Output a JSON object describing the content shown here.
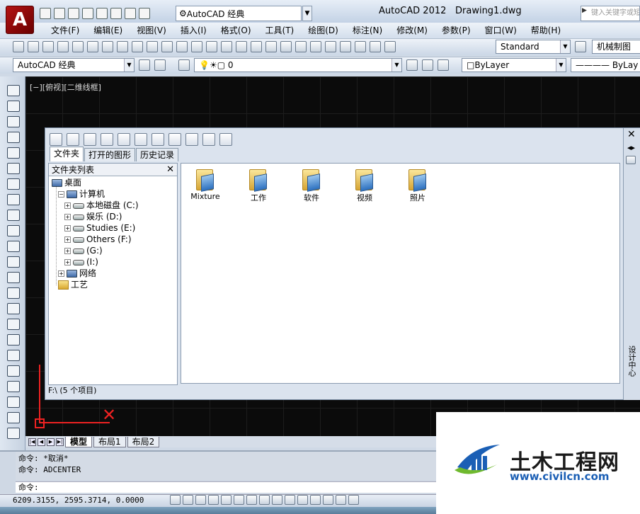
{
  "titlebar": {
    "app_logo": "A",
    "workspace": "AutoCAD 经典",
    "app_title": "AutoCAD 2012",
    "doc_title": "Drawing1.dwg",
    "search_placeholder": "键入关键字或短语"
  },
  "menu": [
    "文件(F)",
    "编辑(E)",
    "视图(V)",
    "插入(I)",
    "格式(O)",
    "工具(T)",
    "绘图(D)",
    "标注(N)",
    "修改(M)",
    "参数(P)",
    "窗口(W)",
    "帮助(H)"
  ],
  "toolbar1": {
    "text_style": "Standard",
    "dim_style": "机械制图"
  },
  "toolbar2": {
    "workspace": "AutoCAD 经典",
    "layer": "0",
    "color": "ByLayer",
    "linetype": "ByLay"
  },
  "viewport_label": "[−][俯视][二维线框]",
  "design_center": {
    "tabs": [
      "文件夹",
      "打开的图形",
      "历史记录"
    ],
    "tree_header": "文件夹列表",
    "tree": [
      {
        "label": "桌面",
        "type": "desktop",
        "indent": 0,
        "exp": ""
      },
      {
        "label": "计算机",
        "type": "computer",
        "indent": 1,
        "exp": "−"
      },
      {
        "label": "本地磁盘 (C:)",
        "type": "drive",
        "indent": 2,
        "exp": "+"
      },
      {
        "label": "娱乐 (D:)",
        "type": "drive",
        "indent": 2,
        "exp": "+"
      },
      {
        "label": "Studies (E:)",
        "type": "drive",
        "indent": 2,
        "exp": "+"
      },
      {
        "label": "Others (F:)",
        "type": "drive",
        "indent": 2,
        "exp": "+"
      },
      {
        "label": "(G:)",
        "type": "drive",
        "indent": 2,
        "exp": "+"
      },
      {
        "label": "(I:)",
        "type": "drive",
        "indent": 2,
        "exp": "+"
      },
      {
        "label": "网络",
        "type": "network",
        "indent": 1,
        "exp": "+"
      },
      {
        "label": "工艺",
        "type": "folder",
        "indent": 1,
        "exp": ""
      }
    ],
    "status": "F:\\ (5 个项目)",
    "files": [
      "Mixture",
      "工作",
      "软件",
      "视频",
      "照片"
    ],
    "side_label": "设计中心"
  },
  "layout_tabs": [
    "模型",
    "布局1",
    "布局2"
  ],
  "command": {
    "history": [
      "命令: *取消*",
      "命令: ADCENTER"
    ],
    "prompt": "命令:"
  },
  "status": {
    "coords": "6209.3155, 2595.3714, 0.0000"
  },
  "watermark": {
    "name": "土木工程网",
    "url": "www.civilcn.com"
  }
}
